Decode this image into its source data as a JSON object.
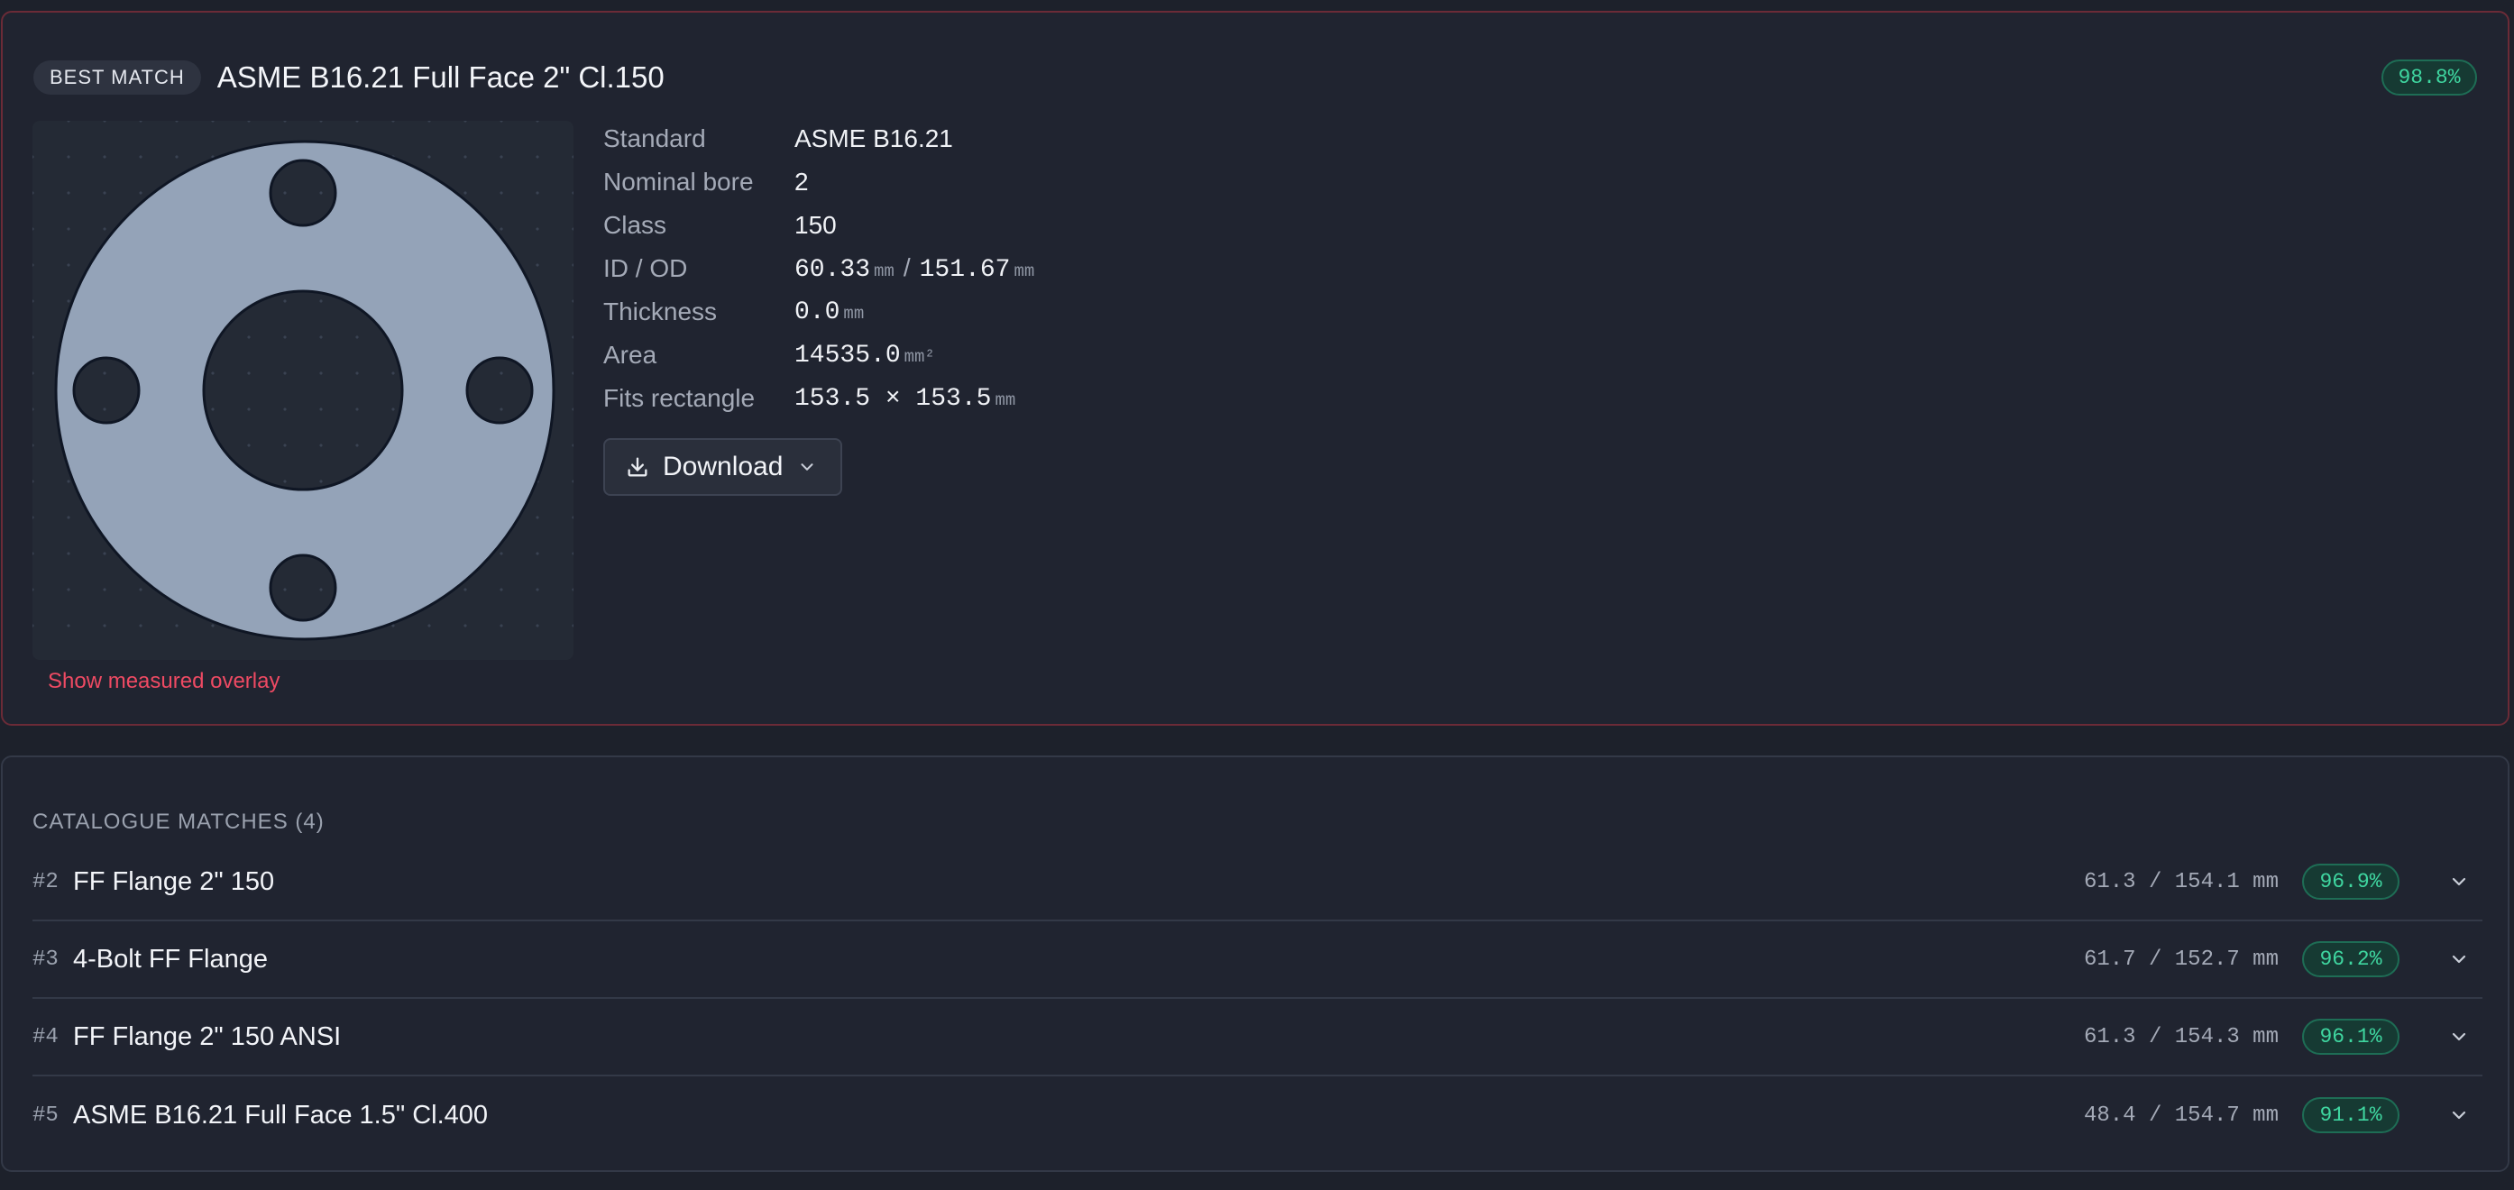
{
  "best": {
    "badge": "BEST MATCH",
    "title": "ASME B16.21 Full Face 2\" Cl.150",
    "score": "98.8%",
    "overlay_link": "Show measured overlay",
    "download_label": "Download",
    "specs": {
      "standard_label": "Standard",
      "standard_value": "ASME B16.21",
      "bore_label": "Nominal bore",
      "bore_value": "2",
      "class_label": "Class",
      "class_value": "150",
      "idod_label": "ID / OD",
      "id_value": "60.33",
      "id_unit": "mm",
      "idod_sep": "/",
      "od_value": "151.67",
      "od_unit": "mm",
      "thickness_label": "Thickness",
      "thickness_value": "0.0",
      "thickness_unit": "mm",
      "area_label": "Area",
      "area_value": "14535.0",
      "area_unit": "mm²",
      "fits_label": "Fits rectangle",
      "fits_value": "153.5 × 153.5",
      "fits_unit": "mm"
    }
  },
  "catalogue": {
    "heading": "CATALOGUE MATCHES (4)",
    "items": [
      {
        "rank": "#2",
        "name": "FF Flange 2\" 150",
        "dims": "61.3 / 154.1 mm",
        "score": "96.9%"
      },
      {
        "rank": "#3",
        "name": "4-Bolt FF Flange",
        "dims": "61.7 / 152.7 mm",
        "score": "96.2%"
      },
      {
        "rank": "#4",
        "name": "FF Flange 2\" 150 ANSI",
        "dims": "61.3 / 154.3 mm",
        "score": "96.1%"
      },
      {
        "rank": "#5",
        "name": "ASME B16.21 Full Face 1.5\" Cl.400",
        "dims": "48.4 / 154.7 mm",
        "score": "91.1%"
      }
    ]
  },
  "colors": {
    "accent_red": "#ee4a63",
    "score_green": "#3fd6a0",
    "gasket_fill": "#94a3b8"
  },
  "icons": {
    "download": "download-icon",
    "chevron": "chevron-down-icon"
  }
}
